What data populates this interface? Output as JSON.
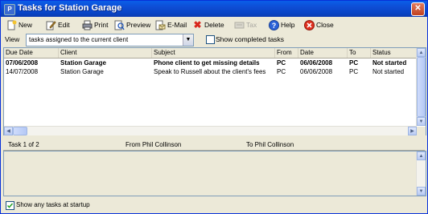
{
  "window": {
    "title": "Tasks for Station Garage",
    "app_icon": "P"
  },
  "toolbar": {
    "new": "New",
    "edit": "Edit",
    "print": "Print",
    "preview": "Preview",
    "email": "E-Mail",
    "delete": "Delete",
    "tax": "Tax",
    "help": "Help",
    "close": "Close"
  },
  "view": {
    "label": "View",
    "selected": "tasks assigned to the current client",
    "show_completed_label": "Show completed tasks",
    "show_completed_checked": false
  },
  "table": {
    "columns": [
      "Due Date",
      "Client",
      "Subject",
      "From",
      "Date",
      "To",
      "Status"
    ],
    "rows": [
      {
        "due": "07/06/2008",
        "client": "Station Garage",
        "subject": "Phone client to get missing details",
        "from": "PC",
        "date": "06/06/2008",
        "to": "PC",
        "status": "Not started",
        "bold": true
      },
      {
        "due": "14/07/2008",
        "client": "Station Garage",
        "subject": "Speak to Russell about the client's fees",
        "from": "PC",
        "date": "06/06/2008",
        "to": "PC",
        "status": "Not started",
        "bold": false
      }
    ]
  },
  "detail": {
    "count": "Task 1 of 2",
    "from": "From Phil Collinson",
    "to": "To Phil Collinson"
  },
  "footer": {
    "show_at_startup_label": "Show any tasks at startup",
    "show_at_startup_checked": true
  }
}
